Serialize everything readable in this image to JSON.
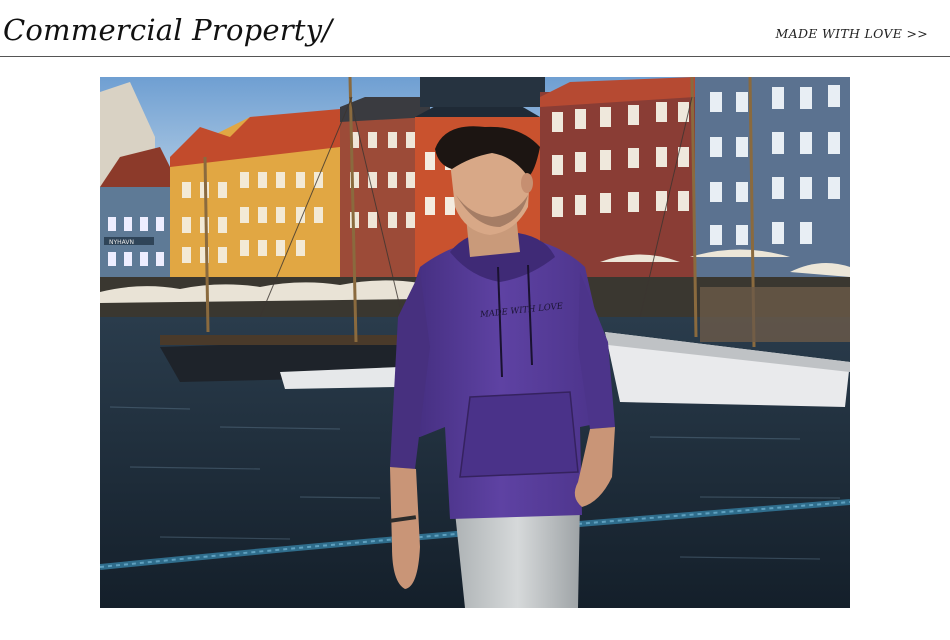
{
  "header": {
    "title": "Commercial Property/",
    "tagline": "MADE WITH LOVE >>"
  },
  "photo": {
    "hoodie_print": "MADE WITH LOVE",
    "sign_text": "NYHAVN"
  },
  "colors": {
    "hoodie": "#5a3d9c",
    "water": "#1b2b3a",
    "rope": "#2f6d8c",
    "sky": "#8fb6dc"
  }
}
